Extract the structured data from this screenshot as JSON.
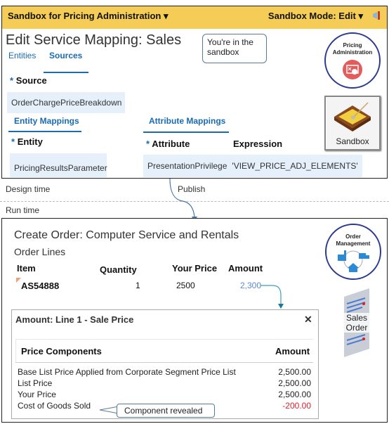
{
  "design_time": {
    "banner": {
      "sandbox_name": "Sandbox for Pricing Administration ▾",
      "mode": "Sandbox Mode: Edit ▾",
      "icon": "megaphone-icon",
      "color": "#f5cc55"
    },
    "page_title": "Edit Service Mapping: Sales",
    "tabs": [
      {
        "label": "Entities",
        "active": false
      },
      {
        "label": "Sources",
        "active": true
      }
    ],
    "callout": "You're in the sandbox",
    "source": {
      "label_star": "*",
      "label": "Source",
      "value": "OrderChargePriceBreakdown"
    },
    "entity_mappings": {
      "title": "Entity Mappings",
      "label_star": "*",
      "label": "Entity",
      "value": "PricingResultsParameter"
    },
    "attribute_mappings": {
      "title": "Attribute Mappings",
      "columns": [
        {
          "star": "*",
          "label": "Attribute"
        },
        {
          "label": "Expression"
        }
      ],
      "rows": [
        {
          "attribute": "PresentationPrivilege",
          "expression": "'VIEW_PRICE_ADJ_ELEMENTS'"
        }
      ]
    },
    "pricing_badge": {
      "line1": "Pricing",
      "line2": "Administration",
      "icon": "price-list-icon"
    },
    "sandbox_button": {
      "label": "Sandbox",
      "icon": "sandbox-icon"
    }
  },
  "flow": {
    "design_time_label": "Design time",
    "publish_label": "Publish",
    "run_time_label": "Run time"
  },
  "run_time": {
    "order_title": "Create Order: Computer Service and Rentals",
    "section": "Order Lines",
    "columns": [
      "Item",
      "Quantity",
      "Your Price",
      "Amount"
    ],
    "line": {
      "item": "AS54888",
      "quantity": "1",
      "your_price": "2500",
      "amount": "2,300"
    },
    "order_badge": {
      "line1": "Order",
      "line2": "Management",
      "icon": "order-fulfillment-icon"
    },
    "sales_order": {
      "line1": "Sales",
      "line2": "Order",
      "icon": "document-icon"
    },
    "popup": {
      "title": "Amount: Line 1 - Sale Price",
      "close": "✕",
      "columns": [
        "Price Components",
        "Amount"
      ],
      "rows": [
        {
          "component": "Base List Price Applied from Corporate  Segment Price List",
          "amount": "2,500.00"
        },
        {
          "component": "List Price",
          "amount": "2,500.00"
        },
        {
          "component": "Your Price",
          "amount": "2,500.00"
        },
        {
          "component": "Cost of Goods Sold",
          "amount": "-200.00",
          "negative": true
        }
      ],
      "callout": "Component  revealed"
    }
  }
}
